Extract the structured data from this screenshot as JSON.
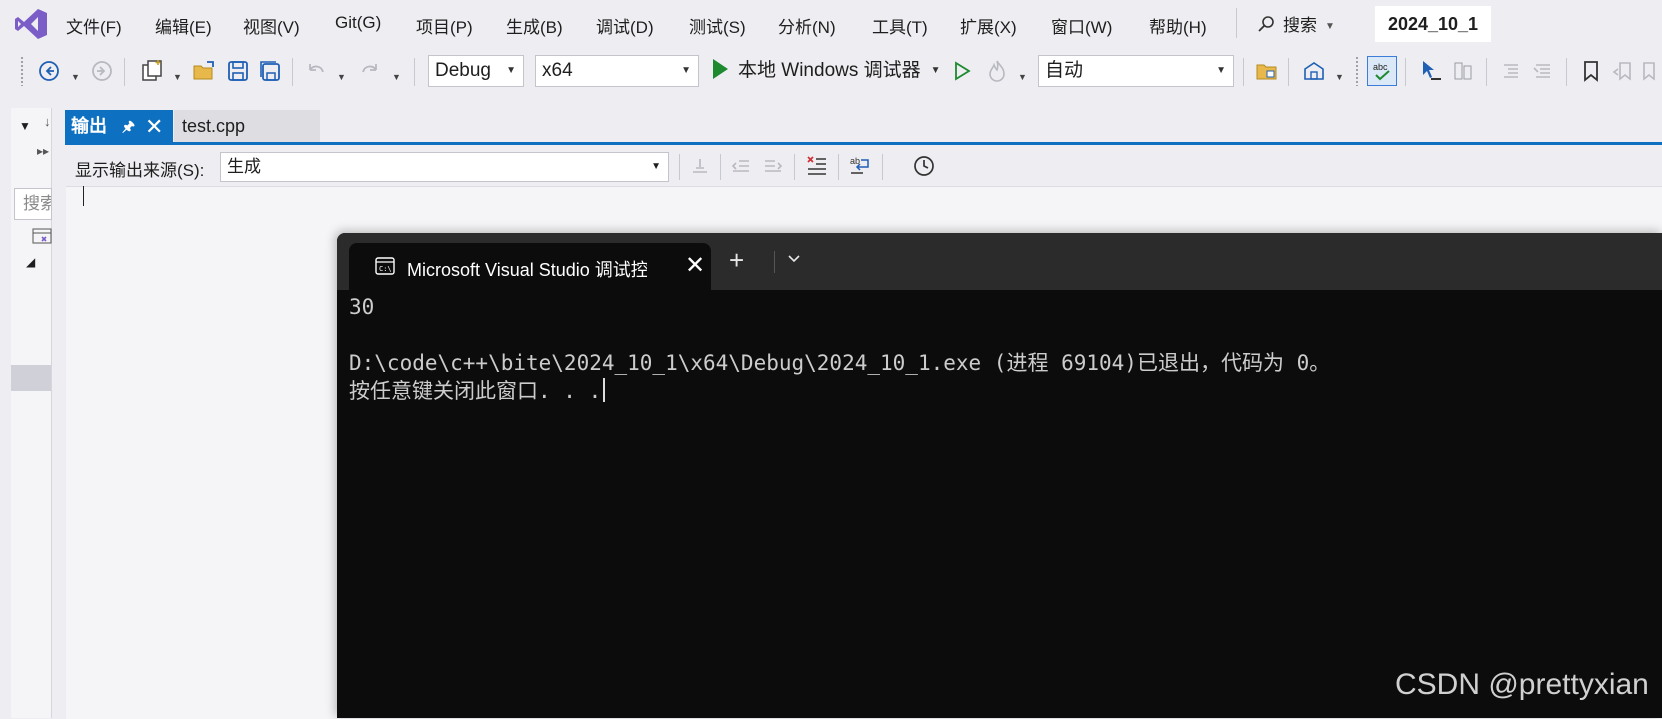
{
  "menu": {
    "items": [
      "文件(F)",
      "编辑(E)",
      "视图(V)",
      "Git(G)",
      "项目(P)",
      "生成(B)",
      "调试(D)",
      "测试(S)",
      "分析(N)",
      "工具(T)",
      "扩展(X)",
      "窗口(W)",
      "帮助(H)"
    ],
    "search_label": "搜索",
    "solution_name": "2024_10_1"
  },
  "toolbar": {
    "configuration": "Debug",
    "platform": "x64",
    "run_label": "本地 Windows 调试器",
    "auto_combo": "自动"
  },
  "left_panel": {
    "search_placeholder": "搜索"
  },
  "tabs": {
    "output_label": "输出",
    "doc_label": "test.cpp"
  },
  "output": {
    "source_label": "显示输出来源(S):",
    "source_value": "生成"
  },
  "terminal": {
    "tab_title": "Microsoft Visual Studio 调试控制台",
    "lines": [
      "30",
      "",
      "D:\\code\\c++\\bite\\2024_10_1\\x64\\Debug\\2024_10_1.exe (进程 69104)已退出，代码为 0。",
      "按任意键关闭此窗口. . ."
    ]
  },
  "watermark": "CSDN @prettyxian",
  "colors": {
    "accent": "#0e70c0",
    "vs_purple": "#7a5dc7",
    "run_green": "#1d8a30",
    "terminal_bg": "#0c0c0c"
  }
}
